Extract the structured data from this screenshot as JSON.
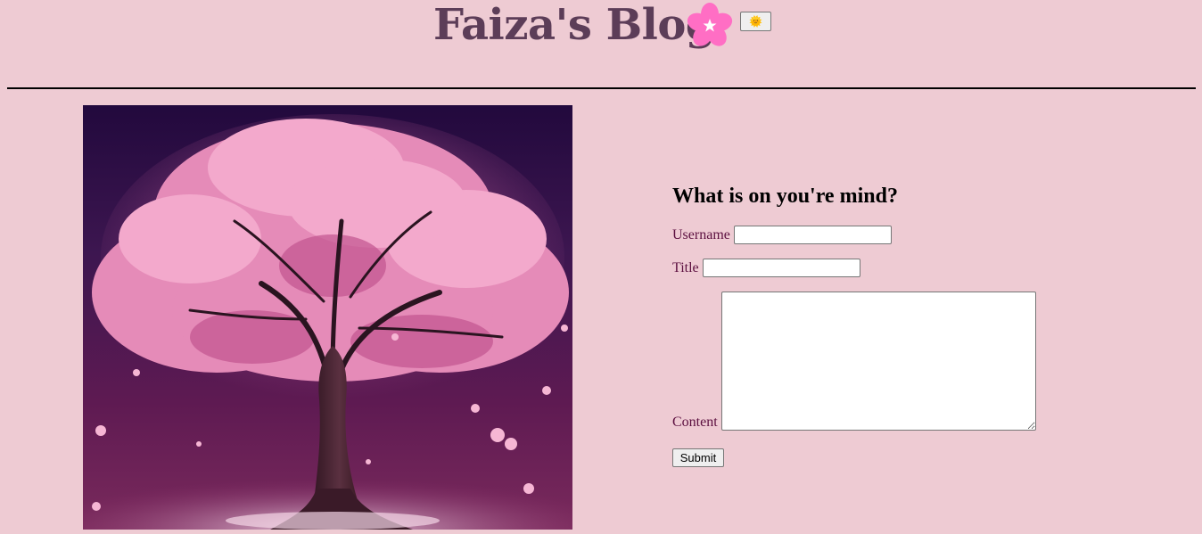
{
  "header": {
    "title": "Faiza's Blog",
    "flower_icon": "cherry-blossom-icon",
    "theme_toggle_icon": "sun-face-icon",
    "theme_toggle_glyph": "🌞"
  },
  "hero": {
    "image": "cherry-blossom-tree-illustration"
  },
  "form": {
    "heading": "What is on you're mind?",
    "username_label": "Username",
    "username_value": "",
    "title_label": "Title",
    "title_value": "",
    "content_label": "Content",
    "content_value": "",
    "submit_label": "Submit"
  },
  "colors": {
    "background": "#eecbd3",
    "title": "#5c3d58",
    "label": "#5c1040",
    "flower": "#ff69b4"
  }
}
